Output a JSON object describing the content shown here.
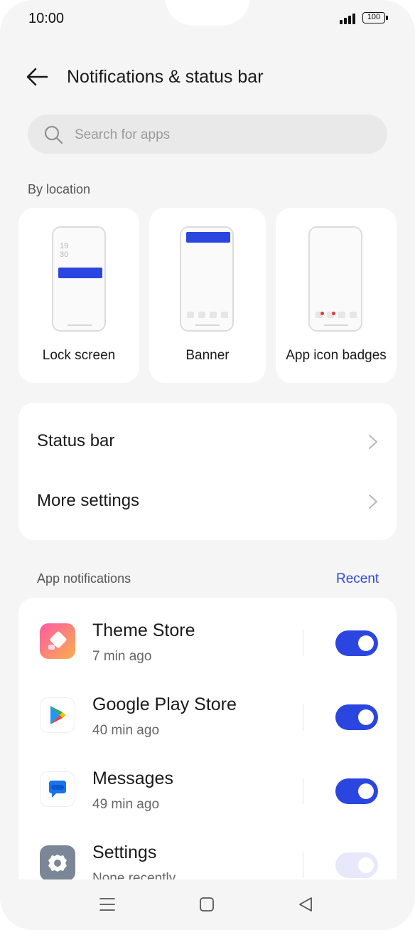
{
  "status_bar": {
    "time": "10:00",
    "battery": "100"
  },
  "header": {
    "title": "Notifications & status bar"
  },
  "search": {
    "placeholder": "Search for apps"
  },
  "by_location": {
    "label": "By location",
    "cards": [
      {
        "label": "Lock screen",
        "clock_top": "19",
        "clock_bottom": "30"
      },
      {
        "label": "Banner"
      },
      {
        "label": "App icon badges"
      }
    ]
  },
  "settings": {
    "items": [
      {
        "label": "Status bar"
      },
      {
        "label": "More settings"
      }
    ]
  },
  "app_notifications": {
    "label": "App notifications",
    "recent_label": "Recent",
    "apps": [
      {
        "name": "Theme Store",
        "time": "7 min ago",
        "enabled": true,
        "icon": "theme-store-icon"
      },
      {
        "name": "Google Play Store",
        "time": "40 min ago",
        "enabled": true,
        "icon": "google-play-icon"
      },
      {
        "name": "Messages",
        "time": "49 min ago",
        "enabled": true,
        "icon": "messages-icon"
      },
      {
        "name": "Settings",
        "time": "None recently",
        "enabled": false,
        "icon": "settings-gear-icon"
      }
    ]
  },
  "colors": {
    "accent": "#2b46e0",
    "background": "#f5f5f5",
    "card": "#ffffff",
    "badge_dot": "#e53935"
  }
}
